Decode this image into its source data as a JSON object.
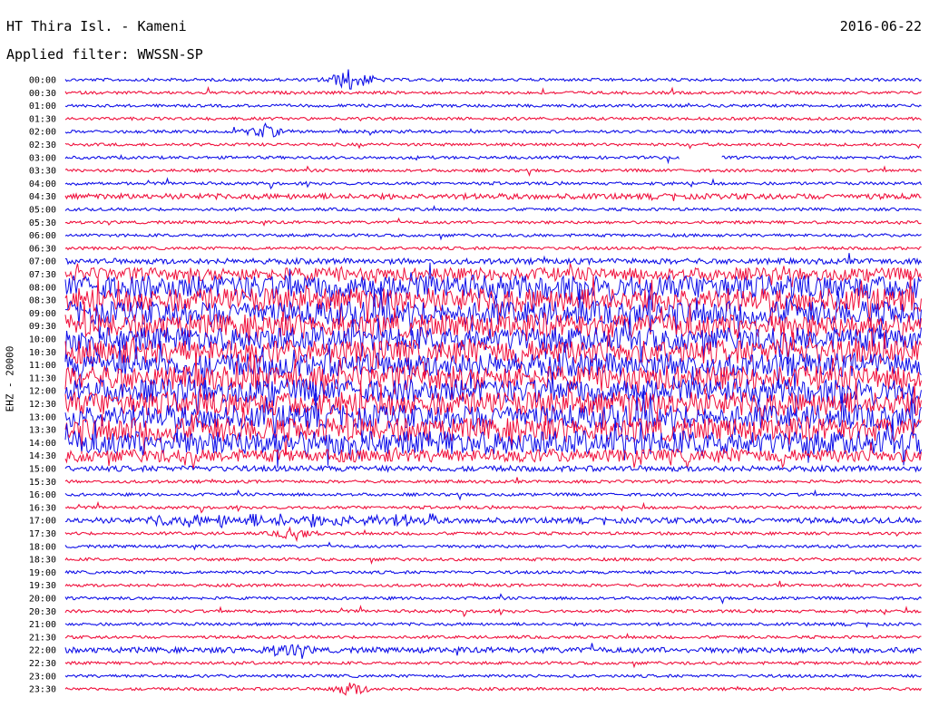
{
  "header": {
    "station": "HT Thira Isl. - Kameni",
    "filter": "Applied filter: WWSSN-SP",
    "date": "2016-06-22",
    "channel": "EHZ - 20000"
  },
  "colors": {
    "trace_a": "#1010e8",
    "trace_b": "#f0103c",
    "background": "#ffffff",
    "text": "#000000"
  },
  "chart_data": {
    "type": "line",
    "title": "HT Thira Isl. - Kameni",
    "subtitle": "Applied filter: WWSSN-SP",
    "ylabel": "EHZ - 20000",
    "xlabel": "",
    "date": "2016-06-22",
    "grid": false,
    "legend": "none",
    "traces": [
      {
        "label": "00:00",
        "color": "blue",
        "noise": "low",
        "events": [
          "spike ~min 20"
        ]
      },
      {
        "label": "00:30",
        "color": "red",
        "noise": "low",
        "events": []
      },
      {
        "label": "01:00",
        "color": "blue",
        "noise": "low",
        "events": []
      },
      {
        "label": "01:30",
        "color": "red",
        "noise": "low",
        "events": []
      },
      {
        "label": "02:00",
        "color": "blue",
        "noise": "low",
        "events": [
          "event ~min 14"
        ]
      },
      {
        "label": "02:30",
        "color": "red",
        "noise": "low",
        "events": []
      },
      {
        "label": "03:00",
        "color": "blue",
        "noise": "low",
        "events": [
          "gap ~min 43-46"
        ]
      },
      {
        "label": "03:30",
        "color": "red",
        "noise": "low",
        "events": []
      },
      {
        "label": "04:00",
        "color": "blue",
        "noise": "low",
        "events": []
      },
      {
        "label": "04:30",
        "color": "red",
        "noise": "medium",
        "events": []
      },
      {
        "label": "05:00",
        "color": "blue",
        "noise": "low",
        "events": []
      },
      {
        "label": "05:30",
        "color": "red",
        "noise": "low",
        "events": []
      },
      {
        "label": "06:00",
        "color": "blue",
        "noise": "low",
        "events": []
      },
      {
        "label": "06:30",
        "color": "red",
        "noise": "low",
        "events": []
      },
      {
        "label": "07:00",
        "color": "blue",
        "noise": "medium",
        "events": []
      },
      {
        "label": "07:30",
        "color": "red",
        "noise": "high",
        "events": []
      },
      {
        "label": "08:00",
        "color": "blue",
        "noise": "very high",
        "events": []
      },
      {
        "label": "08:30",
        "color": "red",
        "noise": "very high",
        "events": []
      },
      {
        "label": "09:00",
        "color": "blue",
        "noise": "very high",
        "events": []
      },
      {
        "label": "09:30",
        "color": "red",
        "noise": "very high",
        "events": []
      },
      {
        "label": "10:00",
        "color": "blue",
        "noise": "very high",
        "events": []
      },
      {
        "label": "10:30",
        "color": "red",
        "noise": "very high",
        "events": []
      },
      {
        "label": "11:00",
        "color": "blue",
        "noise": "very high",
        "events": []
      },
      {
        "label": "11:30",
        "color": "red",
        "noise": "very high",
        "events": []
      },
      {
        "label": "12:00",
        "color": "blue",
        "noise": "very high",
        "events": []
      },
      {
        "label": "12:30",
        "color": "red",
        "noise": "very high",
        "events": []
      },
      {
        "label": "13:00",
        "color": "blue",
        "noise": "very high",
        "events": []
      },
      {
        "label": "13:30",
        "color": "red",
        "noise": "very high",
        "events": []
      },
      {
        "label": "14:00",
        "color": "blue",
        "noise": "very high",
        "events": []
      },
      {
        "label": "14:30",
        "color": "red",
        "noise": "high",
        "events": []
      },
      {
        "label": "15:00",
        "color": "blue",
        "noise": "medium",
        "events": []
      },
      {
        "label": "15:30",
        "color": "red",
        "noise": "low",
        "events": []
      },
      {
        "label": "16:00",
        "color": "blue",
        "noise": "low",
        "events": []
      },
      {
        "label": "16:30",
        "color": "red",
        "noise": "low",
        "events": []
      },
      {
        "label": "17:00",
        "color": "blue",
        "noise": "medium",
        "events": [
          "sustained tremor ~min 7-25"
        ]
      },
      {
        "label": "17:30",
        "color": "red",
        "noise": "low",
        "events": [
          "event ~min 16"
        ]
      },
      {
        "label": "18:00",
        "color": "blue",
        "noise": "low",
        "events": []
      },
      {
        "label": "18:30",
        "color": "red",
        "noise": "low",
        "events": []
      },
      {
        "label": "19:00",
        "color": "blue",
        "noise": "low",
        "events": []
      },
      {
        "label": "19:30",
        "color": "red",
        "noise": "low",
        "events": []
      },
      {
        "label": "20:00",
        "color": "blue",
        "noise": "low",
        "events": []
      },
      {
        "label": "20:30",
        "color": "red",
        "noise": "low",
        "events": []
      },
      {
        "label": "21:00",
        "color": "blue",
        "noise": "low",
        "events": []
      },
      {
        "label": "21:30",
        "color": "red",
        "noise": "low",
        "events": []
      },
      {
        "label": "22:00",
        "color": "blue",
        "noise": "medium",
        "events": [
          "event ~min 14-17"
        ]
      },
      {
        "label": "22:30",
        "color": "red",
        "noise": "low",
        "events": []
      },
      {
        "label": "23:00",
        "color": "blue",
        "noise": "low",
        "events": []
      },
      {
        "label": "23:30",
        "color": "red",
        "noise": "low",
        "events": [
          "event ~min 20"
        ]
      }
    ]
  }
}
